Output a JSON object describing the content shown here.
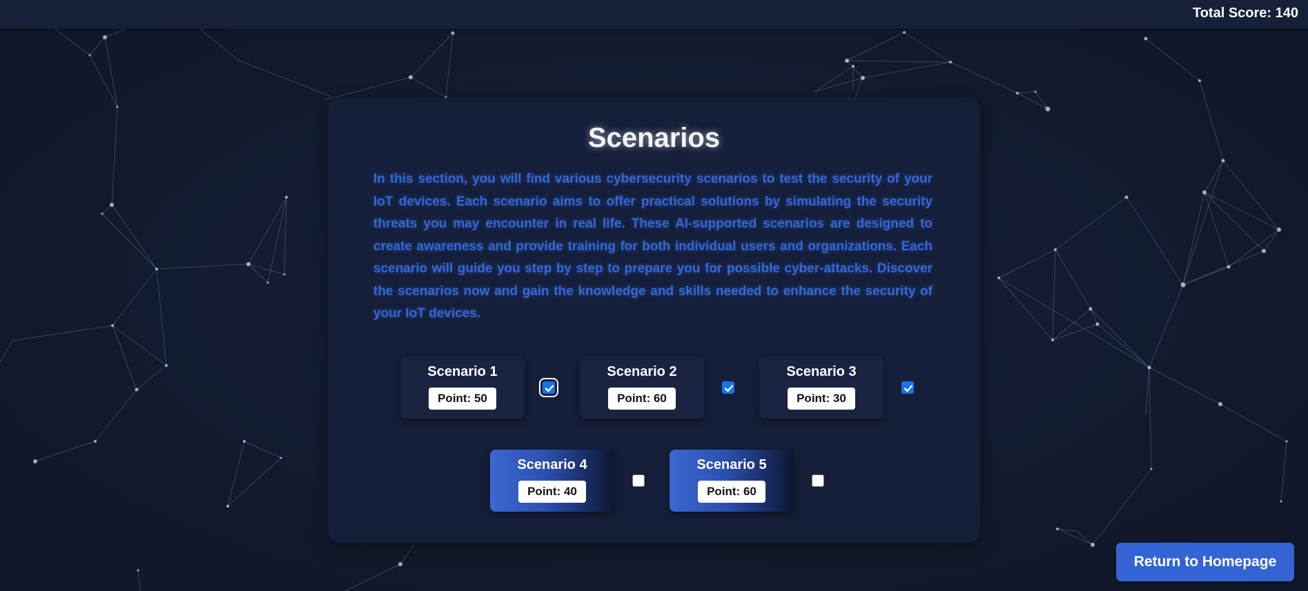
{
  "header": {
    "total_score": "Total Score: 140"
  },
  "main": {
    "title": "Scenarios",
    "description": "In this section, you will find various cybersecurity scenarios to test the security of your IoT devices. Each scenario aims to offer practical solutions by simulating the security threats you may encounter in real life. These AI-supported scenarios are designed to create awareness and provide training for both individual users and organizations. Each scenario will guide you step by step to prepare you for possible cyber-attacks. Discover the scenarios now and gain the knowledge and skills needed to enhance the security of your IoT devices.",
    "scenarios": [
      {
        "name": "Scenario 1",
        "points": "Point: 50",
        "completed": true
      },
      {
        "name": "Scenario 2",
        "points": "Point: 60",
        "completed": true
      },
      {
        "name": "Scenario 3",
        "points": "Point: 30",
        "completed": true
      },
      {
        "name": "Scenario 4",
        "points": "Point: 40",
        "completed": false
      },
      {
        "name": "Scenario 5",
        "points": "Point: 60",
        "completed": false
      }
    ]
  },
  "footer": {
    "return_label": "Return to Homepage"
  },
  "colors": {
    "background": "#121a2e",
    "card": "#161f3a",
    "description_text": "#3567d4",
    "accent_button": "#3364d4",
    "checkbox_checked": "#1a73e8"
  }
}
